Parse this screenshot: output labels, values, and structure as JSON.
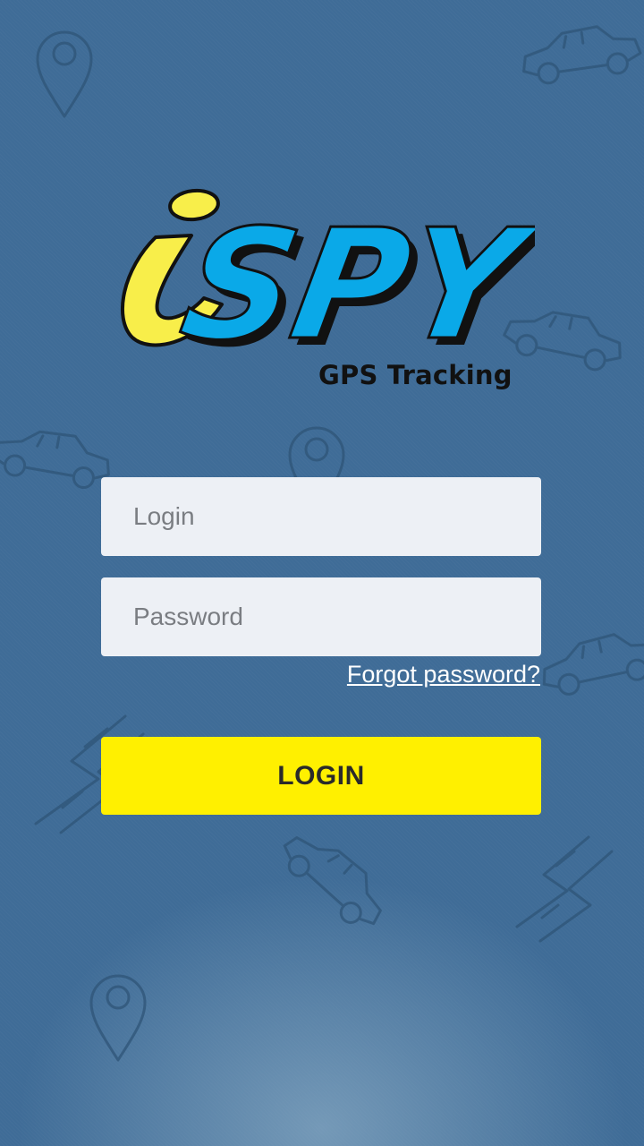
{
  "logo": {
    "letter_i": "i",
    "word": "SPY",
    "tagline": "GPS Tracking",
    "colors": {
      "i_fill": "#f8ee4a",
      "spy_fill": "#0aa9e8",
      "outline": "#111111"
    }
  },
  "form": {
    "login": {
      "value": "",
      "placeholder": "Login"
    },
    "password": {
      "value": "",
      "placeholder": "Password"
    },
    "forgot_label": "Forgot password?",
    "submit_label": "LOGIN"
  },
  "theme": {
    "background": "#3f6c97",
    "button": "#fff000",
    "field": "#edf0f5",
    "link": "#ffffff"
  },
  "decorations": [
    "map-pin-icon",
    "car-icon",
    "road-icon"
  ]
}
